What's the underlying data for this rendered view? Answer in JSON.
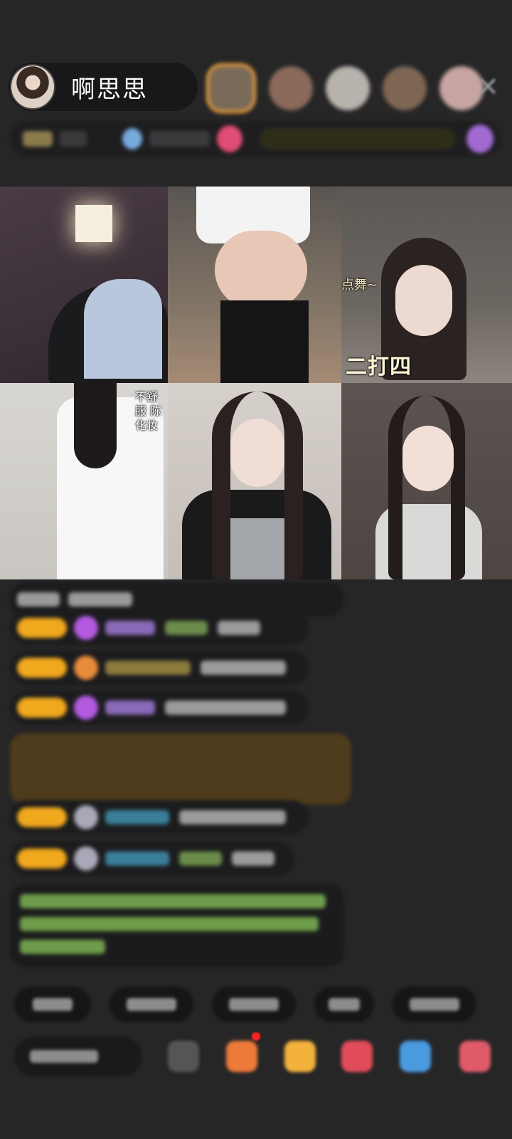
{
  "host": {
    "name": "啊思思",
    "avatar_icon": "host-avatar"
  },
  "header": {
    "viewer_count": 5,
    "close_icon": "close-icon",
    "close_glyph": "✕"
  },
  "video_grid": {
    "tiles": [
      {
        "overlay": ""
      },
      {
        "overlay": ""
      },
      {
        "overlay_top": "点舞~",
        "overlay_bottom": "二打四"
      },
      {
        "overlay": "不舒服 陈化妆"
      },
      {
        "overlay": ""
      },
      {
        "overlay": ""
      }
    ]
  },
  "colors": {
    "background": "#262627",
    "badge_gold": "#f0a81c",
    "gift_bg": "#4f3c1c",
    "system_green": "#6e9c4a"
  }
}
